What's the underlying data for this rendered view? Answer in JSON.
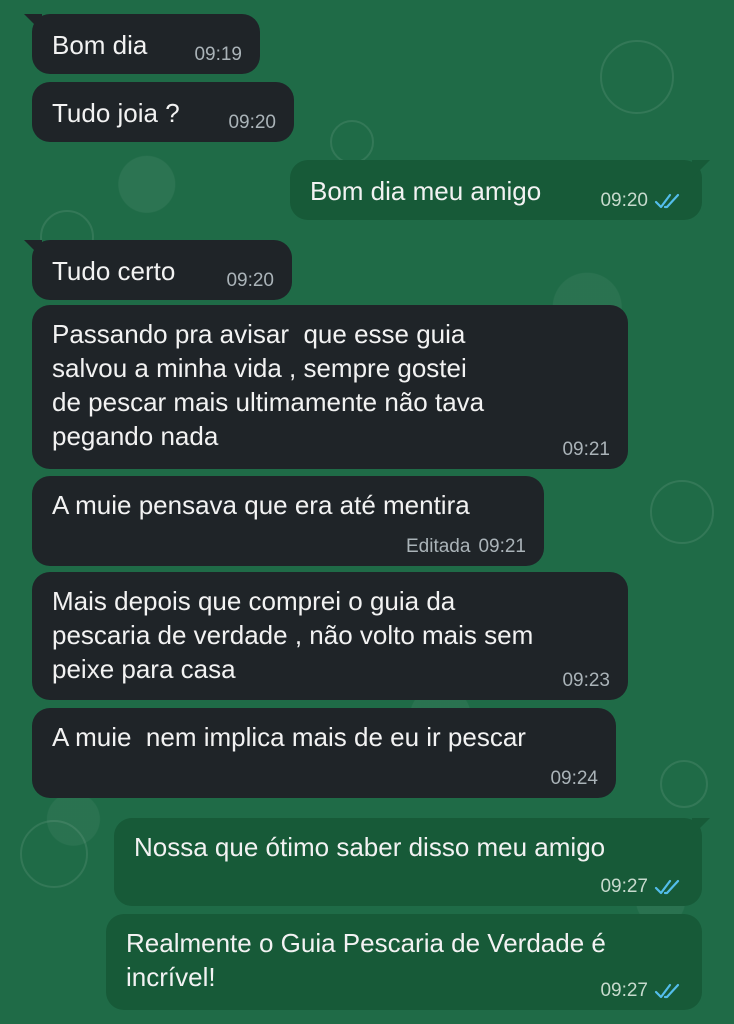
{
  "messages": [
    {
      "id": "m1",
      "direction": "in",
      "text": "Bom dia",
      "time": "09:19"
    },
    {
      "id": "m2",
      "direction": "in",
      "text": "Tudo joia ?",
      "time": "09:20"
    },
    {
      "id": "m3",
      "direction": "out",
      "text": "Bom dia meu amigo",
      "time": "09:20",
      "status": "read"
    },
    {
      "id": "m4",
      "direction": "in",
      "text": "Tudo certo",
      "time": "09:20"
    },
    {
      "id": "m5",
      "direction": "in",
      "text": "Passando pra avisar  que esse guia\nsalvou a minha vida , sempre gostei\nde pescar mais ultimamente não tava\npegando nada",
      "time": "09:21"
    },
    {
      "id": "m6",
      "direction": "in",
      "text": "A muie pensava que era até mentira",
      "edited_label": "Editada",
      "time": "09:21"
    },
    {
      "id": "m7",
      "direction": "in",
      "text": "Mais depois que comprei o guia da\npescaria de verdade , não volto mais sem\npeixe para casa",
      "time": "09:23"
    },
    {
      "id": "m8",
      "direction": "in",
      "text": "A muie  nem implica mais de eu ir pescar",
      "time": "09:24"
    },
    {
      "id": "m9",
      "direction": "out",
      "text": "Nossa que ótimo saber disso meu amigo",
      "time": "09:27",
      "status": "read"
    },
    {
      "id": "m10",
      "direction": "out",
      "text": "Realmente o Guia Pescaria de Verdade é\nincrível!",
      "time": "09:27",
      "status": "read"
    }
  ],
  "colors": {
    "wallpaper": "#1f6b47",
    "incoming_bubble": "#1f2428",
    "outgoing_bubble": "#175a38",
    "read_ticks": "#53bdeb",
    "text": "#f2f2f2"
  },
  "icons": {
    "read_receipt": "double-check-icon"
  }
}
